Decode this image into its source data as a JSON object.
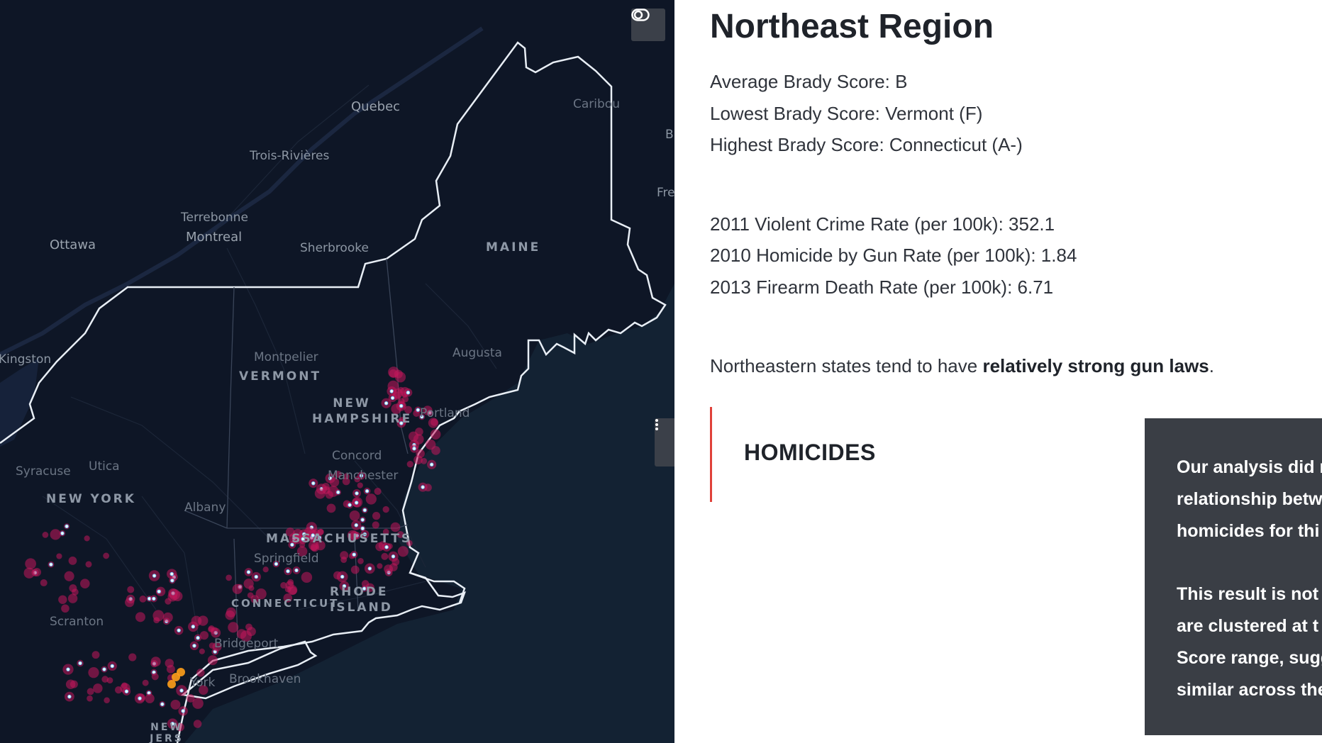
{
  "map": {
    "toggle_icon": "toggle-icon",
    "handle_icon": "vertical-dots-icon",
    "labels": {
      "quebec": "Quebec",
      "trois_rivieres": "Trois-Rivières",
      "caribou": "Caribou",
      "terrebonne": "Terrebonne",
      "montreal": "Montreal",
      "ottawa": "Ottawa",
      "sherbrooke": "Sherbrooke",
      "maine": "MAINE",
      "kingston": "Kingston",
      "montpelier": "Montpelier",
      "vermont": "VERMONT",
      "augusta": "Augusta",
      "new_hampshire_1": "NEW",
      "new_hampshire_2": "HAMPSHIRE",
      "portland": "Portland",
      "concord": "Concord",
      "manchester": "Manchester",
      "syracuse": "Syracuse",
      "utica": "Utica",
      "new_york_state": "NEW YORK",
      "albany": "Albany",
      "massachusetts": "MASSACHUSETTS",
      "springfield": "Springfield",
      "rhode_island_1": "RHODE",
      "rhode_island_2": "ISLAND",
      "connecticut": "CONNECTICUT",
      "scranton": "Scranton",
      "bridgeport": "Bridgeport",
      "brookhaven": "Brookhaven",
      "york": "York",
      "new_jersey_1": "NEW",
      "new_jersey_2": "JERS",
      "edge_b": "B",
      "edge_fre": "Fre"
    },
    "colors": {
      "background": "#0e1626",
      "ocean": "#132233",
      "border": "#e8eef5",
      "hotspot": "#c2185b"
    }
  },
  "region": {
    "title": "Northeast Region",
    "avg_score": "Average Brady Score: B",
    "lowest_score": "Lowest Brady Score: Vermont (F)",
    "highest_score": "Highest Brady Score: Connecticut (A-)",
    "violent_crime": "2011 Violent Crime Rate (per 100k): 352.1",
    "homicide_gun": "2010 Homicide by Gun Rate (per 100k): 1.84",
    "firearm_death": "2013 Firearm Death Rate (per 100k): 6.71",
    "summary_prefix": "Northeastern states tend to have ",
    "summary_bold": "relatively strong gun laws",
    "summary_suffix": "."
  },
  "section": {
    "heading": "HOMICIDES",
    "accent_color": "#e0413a"
  },
  "callout": {
    "paragraph1_lines": [
      "Our analysis did n",
      "relationship betw",
      "homicides for thi"
    ],
    "paragraph2_lines": [
      "This result is not",
      "are clustered at t",
      "Score range, sugg",
      "similar across the"
    ]
  }
}
